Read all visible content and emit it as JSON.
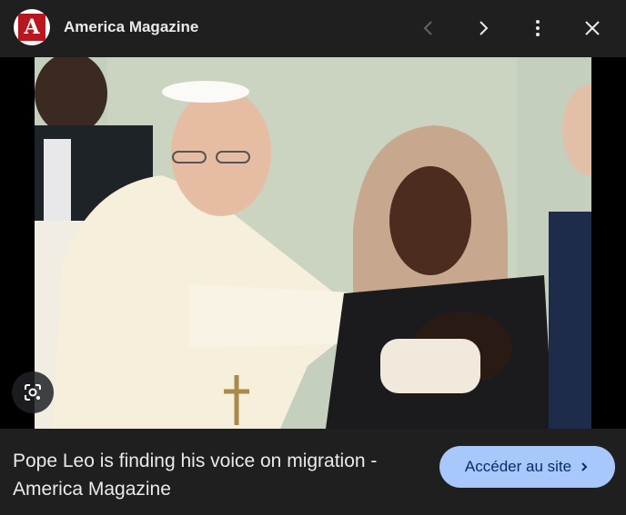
{
  "header": {
    "site_name": "America Magazine",
    "logo_letter": "A"
  },
  "icons": {
    "prev": "chevron-left-icon",
    "next": "chevron-right-icon",
    "more": "more-vert-icon",
    "close": "close-icon",
    "lens": "google-lens-icon"
  },
  "main": {
    "image_alt": "Pope Leo blesses a baby held by a woman"
  },
  "footer": {
    "title": "Pope Leo is finding his voice on migration - America Magazine",
    "visit_label": "Accéder au site"
  },
  "colors": {
    "accent": "#a8c7fa",
    "logo_red": "#b8171f"
  }
}
